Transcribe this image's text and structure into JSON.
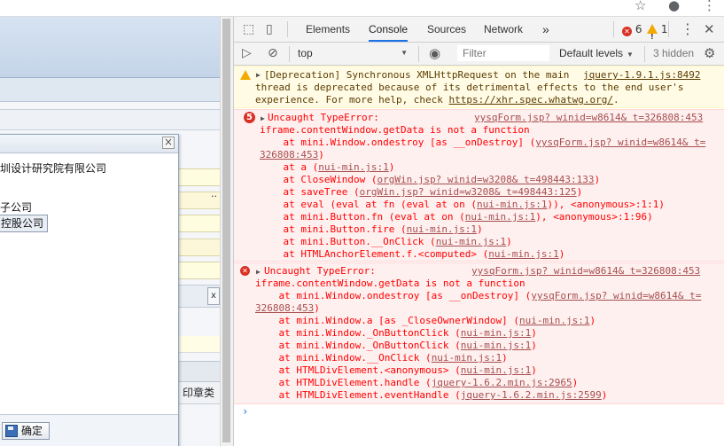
{
  "devtools": {
    "tabs": [
      {
        "label": "Elements"
      },
      {
        "label": "Console"
      },
      {
        "label": "Sources"
      },
      {
        "label": "Network"
      }
    ],
    "more_tabs": "»",
    "error_count": "6",
    "warning_count": "1",
    "toolbar": {
      "context": "top",
      "filter_placeholder": "Filter",
      "levels": "Default levels",
      "hidden": "3 hidden"
    }
  },
  "console": {
    "warning": {
      "line1": "[Deprecation] Synchronous XMLHttpRequest on the main",
      "source": "jquery-1.9.1.js:8492",
      "line2": "thread is deprecated because of its detrimental effects to the end user's",
      "line3_prefix": "experience. For more help, check ",
      "line3_link": "https://xhr.spec.whatwg.org/",
      "line3_suffix": "."
    },
    "error1": {
      "repeat_count": "5",
      "title": "Uncaught TypeError:",
      "source": "yysqForm.jsp? winid=w8614& t=326808:453",
      "message": "iframe.contentWindow.getData is not a function",
      "stack": [
        {
          "prefix": "    at mini.Window.ondestroy [as __onDestroy] (",
          "link": "yysqForm.jsp? winid=w8614& t=",
          "suffix": ""
        },
        {
          "prefix": "",
          "link": "326808:453",
          "suffix": ")"
        },
        {
          "prefix": "    at a (",
          "link": "nui-min.js:1",
          "suffix": ")"
        },
        {
          "prefix": "    at CloseWindow (",
          "link": "orgWin.jsp? winid=w3208& t=498443:133",
          "suffix": ")"
        },
        {
          "prefix": "    at saveTree (",
          "link": "orgWin.jsp? winid=w3208& t=498443:125",
          "suffix": ")"
        },
        {
          "prefix": "    at eval (eval at fn (eval at on (",
          "link": "nui-min.js:1",
          "suffix": ")), <anonymous>:1:1)"
        },
        {
          "prefix": "    at mini.Button.fn (eval at on (",
          "link": "nui-min.js:1",
          "suffix": "), <anonymous>:1:96)"
        },
        {
          "prefix": "    at mini.Button.fire (",
          "link": "nui-min.js:1",
          "suffix": ")"
        },
        {
          "prefix": "    at mini.Button.__OnClick (",
          "link": "nui-min.js:1",
          "suffix": ")"
        },
        {
          "prefix": "    at HTMLAnchorElement.f.<computed> (",
          "link": "nui-min.js:1",
          "suffix": ")"
        }
      ]
    },
    "error2": {
      "title": "Uncaught TypeError:",
      "source": "yysqForm.jsp? winid=w8614& t=326808:453",
      "message": "iframe.contentWindow.getData is not a function",
      "stack": [
        {
          "prefix": "    at mini.Window.ondestroy [as __onDestroy] (",
          "link": "yysqForm.jsp? winid=w8614& t=",
          "suffix": ""
        },
        {
          "prefix": "",
          "link": "326808:453",
          "suffix": ")"
        },
        {
          "prefix": "    at mini.Window.a [as _CloseOwnerWindow] (",
          "link": "nui-min.js:1",
          "suffix": ")"
        },
        {
          "prefix": "    at mini.Window._OnButtonClick (",
          "link": "nui-min.js:1",
          "suffix": ")"
        },
        {
          "prefix": "    at mini.Window._OnButtonClick (",
          "link": "nui-min.js:1",
          "suffix": ")"
        },
        {
          "prefix": "    at mini.Window.__OnClick (",
          "link": "nui-min.js:1",
          "suffix": ")"
        },
        {
          "prefix": "    at HTMLDivElement.<anonymous> (",
          "link": "nui-min.js:1",
          "suffix": ")"
        },
        {
          "prefix": "    at HTMLDivElement.handle (",
          "link": "jquery-1.6.2.min.js:2965",
          "suffix": ")"
        },
        {
          "prefix": "    at HTMLDivElement.eventHandle (",
          "link": "jquery-1.6.2.min.js:2599",
          "suffix": ")"
        }
      ]
    },
    "prompt": "›"
  },
  "app": {
    "dialog": {
      "tree_items": [
        "圳设计研究院有限公司",
        "子公司",
        "控股公司"
      ],
      "ok_label": "确定"
    },
    "column_header": "印章类"
  },
  "colors": {
    "accent": "#1a73e8",
    "error_text": "#ff0000",
    "error_bg": "#fff0f0",
    "warning_bg": "#fffbe5",
    "warning_icon": "#f2a900"
  }
}
